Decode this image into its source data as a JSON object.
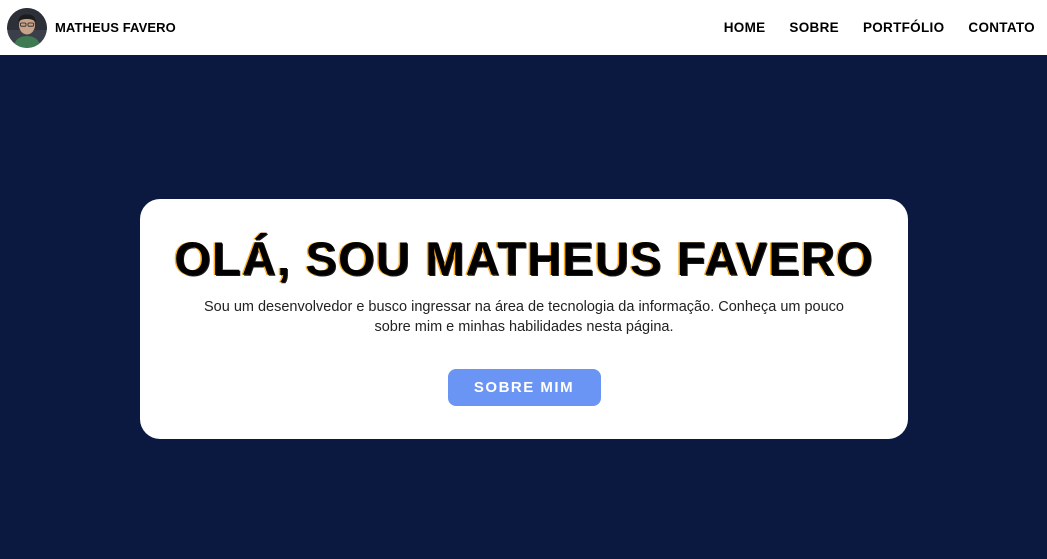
{
  "header": {
    "brand_name": "MATHEUS FAVERO",
    "nav": [
      {
        "label": "HOME"
      },
      {
        "label": "SOBRE"
      },
      {
        "label": "PORTFÓLIO"
      },
      {
        "label": "CONTATO"
      }
    ]
  },
  "hero": {
    "title": "OLÁ, SOU MATHEUS FAVERO",
    "description": "Sou um desenvolvedor e busco ingressar na área de tecnologia da informação. Conheça um pouco sobre mim e minhas habilidades nesta página.",
    "button_label": "SOBRE MIM"
  },
  "colors": {
    "page_background": "#0b1940",
    "header_background": "#ffffff",
    "card_background": "#ffffff",
    "button_background": "#6b95f5"
  }
}
